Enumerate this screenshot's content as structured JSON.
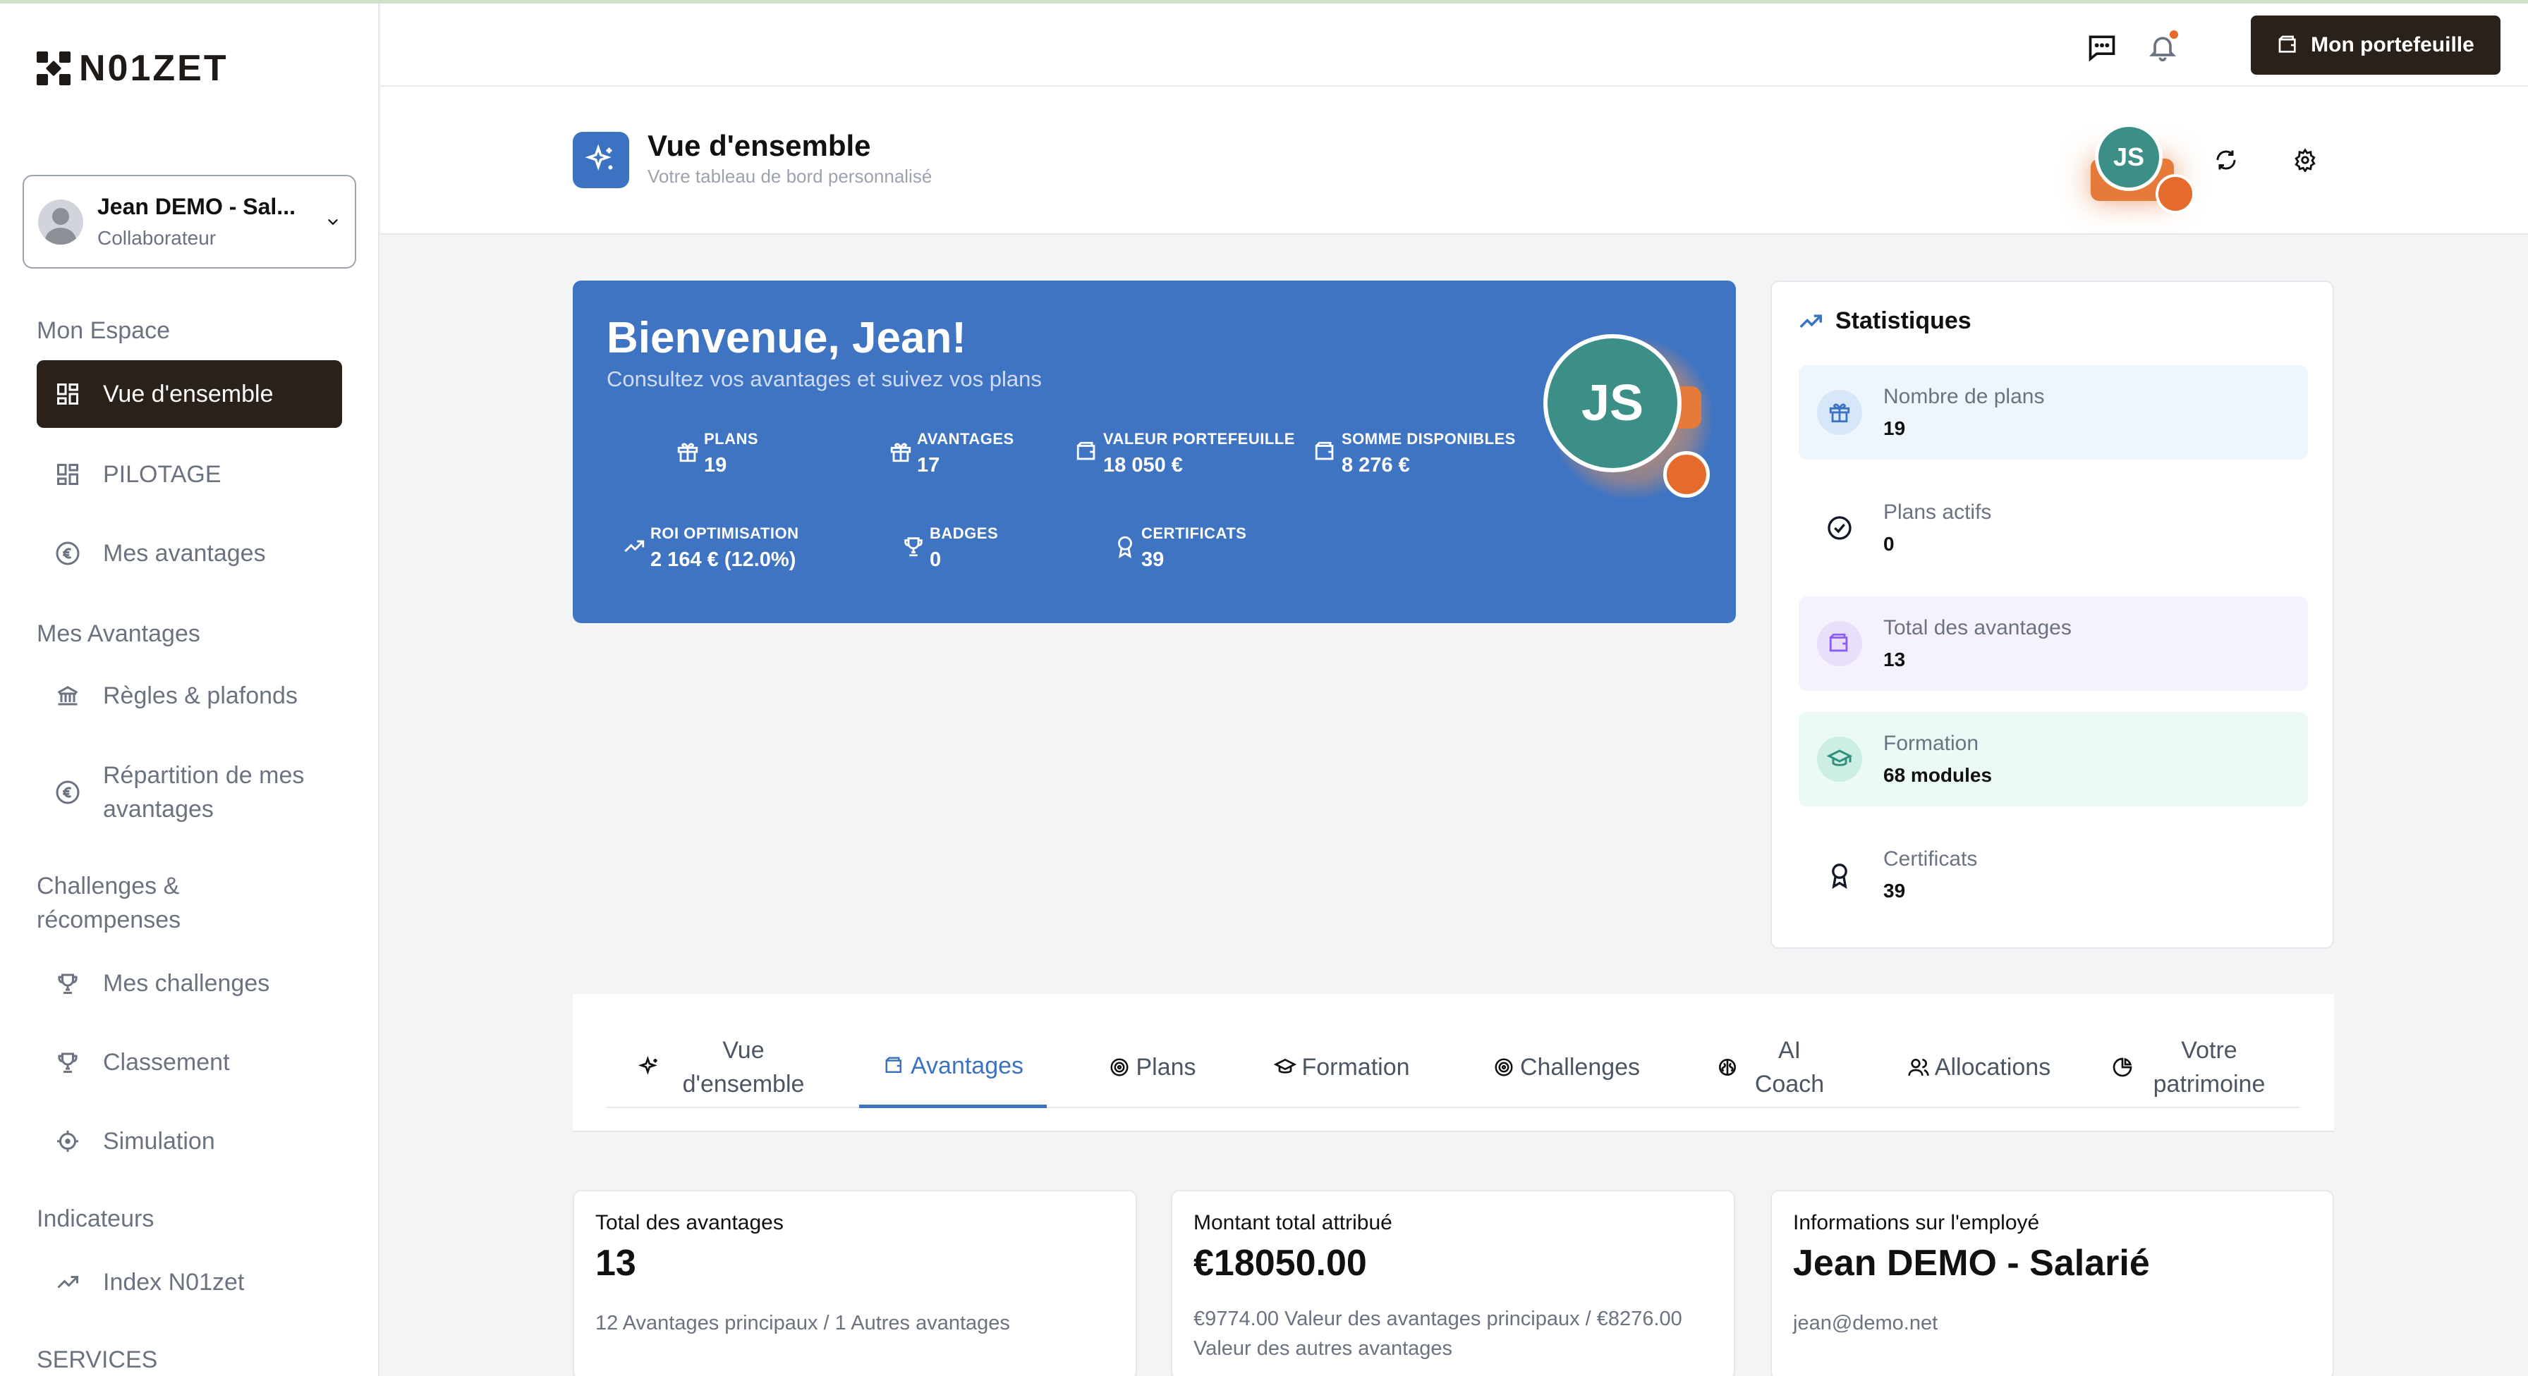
{
  "brand": {
    "name": "N01ZET"
  },
  "user": {
    "name": "Jean DEMO - Sal...",
    "role": "Collaborateur"
  },
  "sidebar": {
    "sections": [
      {
        "label": "Mon Espace"
      },
      {
        "label": "Mes Avantages"
      },
      {
        "label": "Challenges & récompenses"
      },
      {
        "label": "Indicateurs"
      },
      {
        "label": "SERVICES"
      }
    ],
    "items": [
      {
        "label": "Vue d'ensemble",
        "icon": "grid-icon",
        "active": true
      },
      {
        "label": "PILOTAGE",
        "icon": "grid-icon"
      },
      {
        "label": "Mes avantages",
        "icon": "euro-icon"
      },
      {
        "label": "Règles & plafonds",
        "icon": "bank-icon"
      },
      {
        "label": "Répartition de mes avantages",
        "icon": "euro-icon"
      },
      {
        "label": "Mes challenges",
        "icon": "trophy-icon"
      },
      {
        "label": "Classement",
        "icon": "trophy-icon"
      },
      {
        "label": "Simulation",
        "icon": "crosshair-icon"
      },
      {
        "label": "Index N01zet",
        "icon": "trending-up-icon"
      }
    ]
  },
  "topbar": {
    "portfolio_button": "Mon portefeuille"
  },
  "page": {
    "title": "Vue d'ensemble",
    "subtitle": "Votre tableau de bord personnalisé",
    "avatar_initials": "JS"
  },
  "welcome": {
    "title": "Bienvenue, Jean!",
    "subtitle": "Consultez vos avantages et suivez vos plans",
    "avatar_initials": "JS",
    "stats": [
      {
        "label": "PLANS",
        "value": "19",
        "icon": "gift-icon"
      },
      {
        "label": "AVANTAGES",
        "value": "17",
        "icon": "gift-icon"
      },
      {
        "label": "VALEUR PORTEFEUILLE",
        "value": "18 050 €",
        "icon": "wallet-icon"
      },
      {
        "label": "SOMME DISPONIBLES",
        "value": "8 276 €",
        "icon": "wallet-icon"
      },
      {
        "label": "ROI OPTIMISATION",
        "value": "2 164 € (12.0%)",
        "icon": "trending-up-icon"
      },
      {
        "label": "BADGES",
        "value": "0",
        "icon": "trophy-icon"
      },
      {
        "label": "CERTIFICATS",
        "value": "39",
        "icon": "award-icon"
      }
    ]
  },
  "stats_panel": {
    "title": "Statistiques",
    "items": [
      {
        "label": "Nombre de plans",
        "value": "19",
        "icon": "gift-icon",
        "bg": "#eef5fd",
        "icon_bg": "#d7e7fa",
        "icon_color": "#3b73c2"
      },
      {
        "label": "Plans actifs",
        "value": "0",
        "icon": "check-circle-icon",
        "bg": "#ffffff",
        "icon_bg": "#ffffff",
        "icon_color": "#111827"
      },
      {
        "label": "Total des avantages",
        "value": "13",
        "icon": "wallet-icon",
        "bg": "#f6f2fd",
        "icon_bg": "#e9dffb",
        "icon_color": "#8b5cf6"
      },
      {
        "label": "Formation",
        "value": "68 modules",
        "icon": "graduation-cap-icon",
        "bg": "#ebfaf6",
        "icon_bg": "#cdeee5",
        "icon_color": "#2f8f7e"
      },
      {
        "label": "Certificats",
        "value": "39",
        "icon": "award-icon",
        "bg": "#ffffff",
        "icon_bg": "#ffffff",
        "icon_color": "#111827"
      }
    ]
  },
  "tabs": [
    {
      "label": "Vue d'ensemble",
      "icon": "sparkles-icon"
    },
    {
      "label": "Avantages",
      "icon": "wallet-icon",
      "active": true
    },
    {
      "label": "Plans",
      "icon": "target-icon"
    },
    {
      "label": "Formation",
      "icon": "graduation-cap-icon"
    },
    {
      "label": "Challenges",
      "icon": "target-icon"
    },
    {
      "label": "AI Coach",
      "icon": "brain-icon"
    },
    {
      "label": "Allocations",
      "icon": "users-icon"
    },
    {
      "label": "Votre patrimoine",
      "icon": "pie-chart-icon"
    }
  ],
  "cards": [
    {
      "title": "Total des avantages",
      "value": "13",
      "desc": "12 Avantages principaux / 1 Autres avantages"
    },
    {
      "title": "Montant total attribué",
      "value": "€18050.00",
      "desc": "€9774.00 Valeur des avantages principaux / €8276.00 Valeur des autres avantages"
    },
    {
      "title": "Informations sur l'employé",
      "value": "Jean DEMO - Salarié",
      "desc": "jean@demo.net"
    }
  ],
  "colors": {
    "accent": "#3b73c2",
    "dark": "#2b211b",
    "orange": "#e56b2d",
    "teal": "#3c8f86"
  }
}
